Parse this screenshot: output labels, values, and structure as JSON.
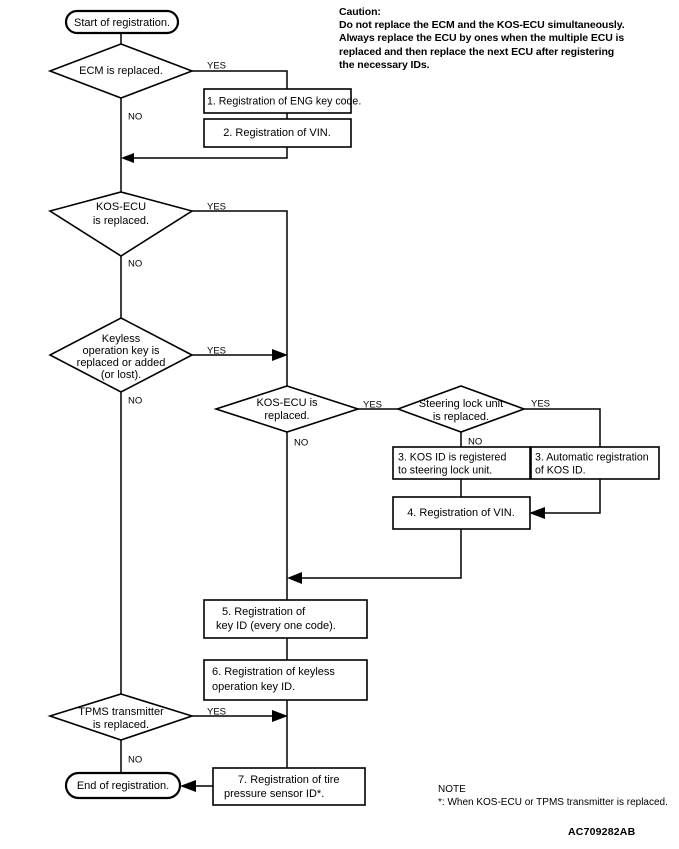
{
  "diagram": {
    "title": "KOS registration procedure flowchart",
    "figure_code": "AC709282AB",
    "caution": {
      "heading": "Caution:",
      "lines": [
        "Do not replace the ECM and the KOS-ECU simultaneously.",
        "Always replace the ECU by ones when the multiple ECU is",
        "replaced and then replace the next ECU after registering",
        "the necessary IDs."
      ]
    },
    "note": {
      "heading": "NOTE",
      "lines": [
        "*: When KOS-ECU or TPMS transmitter is replaced."
      ]
    },
    "nodes": {
      "start": {
        "type": "terminator",
        "label": "Start of registration."
      },
      "end": {
        "type": "terminator",
        "label": "End of registration."
      },
      "d_ecm": {
        "type": "decision",
        "line1": "ECM is replaced."
      },
      "d_kos1": {
        "type": "decision",
        "line1": "KOS-ECU",
        "line2": "is replaced."
      },
      "d_keyless": {
        "type": "decision",
        "line1": "Keyless",
        "line2": "operation key is",
        "line3": "replaced or added",
        "line4": "(or lost)."
      },
      "d_kos2": {
        "type": "decision",
        "line1": "KOS-ECU is",
        "line2": "replaced."
      },
      "d_steering": {
        "type": "decision",
        "line1": "Steering lock unit",
        "line2": "is replaced."
      },
      "d_tpms": {
        "type": "decision",
        "line1": "TPMS transmitter",
        "line2": "is replaced."
      },
      "p1": {
        "type": "process",
        "line1": "1. Registration of ENG key code."
      },
      "p2": {
        "type": "process",
        "line1": "2. Registration of VIN."
      },
      "p3a": {
        "type": "process",
        "line1": "3. KOS ID is registered",
        "line2": "to steering lock unit."
      },
      "p3b": {
        "type": "process",
        "line1": "3. Automatic registration",
        "line2": "of KOS ID."
      },
      "p4": {
        "type": "process",
        "line1": "4. Registration of VIN."
      },
      "p5": {
        "type": "process",
        "line1": "5. Registration of",
        "line2": "key ID (every one code)."
      },
      "p6": {
        "type": "process",
        "line1": "6. Registration of keyless",
        "line2": "operation key ID."
      },
      "p7": {
        "type": "process",
        "line1": "7. Registration of tire",
        "line2": "pressure sensor ID*."
      }
    },
    "edge_labels": {
      "ecm_yes": "YES",
      "ecm_no": "NO",
      "kos1_yes": "YES",
      "kos1_no": "NO",
      "keyless_yes": "YES",
      "keyless_no": "NO",
      "kos2_yes": "YES",
      "kos2_no": "NO",
      "steering_yes": "YES",
      "steering_no": "NO",
      "tpms_yes": "YES",
      "tpms_no": "NO"
    },
    "colors": {
      "stroke": "#000000",
      "fill": "#ffffff",
      "text": "#000000"
    }
  }
}
